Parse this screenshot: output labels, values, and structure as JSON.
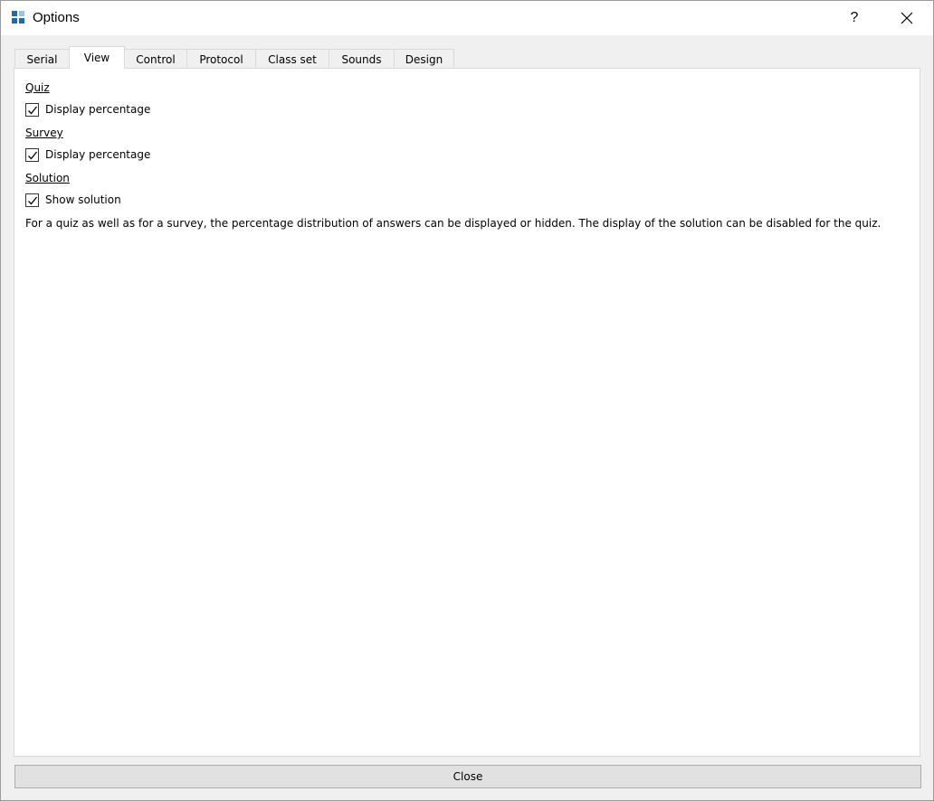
{
  "window": {
    "title": "Options",
    "help_label": "?",
    "close_glyph": "✕"
  },
  "tabs": [
    {
      "label": "Serial"
    },
    {
      "label": "View"
    },
    {
      "label": "Control"
    },
    {
      "label": "Protocol"
    },
    {
      "label": "Class set"
    },
    {
      "label": "Sounds"
    },
    {
      "label": "Design"
    }
  ],
  "active_tab": "View",
  "view": {
    "quiz": {
      "heading": "Quiz",
      "checkbox_label": "Display percentage",
      "checked": true
    },
    "survey": {
      "heading": "Survey",
      "checkbox_label": "Display percentage",
      "checked": true
    },
    "solution": {
      "heading": "Solution",
      "checkbox_label": "Show solution",
      "checked": true
    },
    "description": "For a quiz as well as for a survey, the percentage distribution of answers can be displayed or hidden. The display of the solution can be disabled for the quiz."
  },
  "footer": {
    "close_label": "Close"
  },
  "colors": {
    "accent": "#1a6bb3",
    "panel_bg": "#ffffff",
    "window_bg": "#f0f0f0"
  }
}
